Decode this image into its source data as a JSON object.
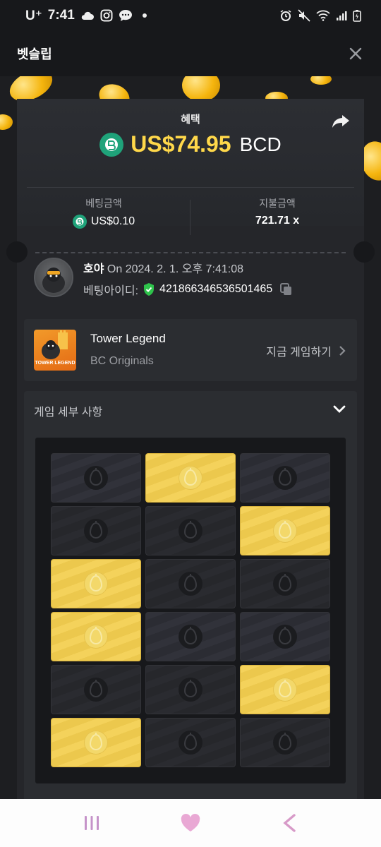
{
  "status_bar": {
    "carrier": "U⁺",
    "time": "7:41"
  },
  "header": {
    "title": "벳슬립"
  },
  "benefit": {
    "label": "혜택",
    "amount": "US$74.95",
    "currency": "BCD"
  },
  "bet_amount": {
    "label": "베팅금액",
    "value": "US$0.10"
  },
  "payout": {
    "label": "지불금액",
    "value": "721.71 x"
  },
  "user": {
    "nickname": "호야",
    "date_prefix": "On",
    "datetime": "2024. 2. 1. 오후 7:41:08",
    "bet_id_label": "베팅아이디:",
    "bet_id": "421866346536501465"
  },
  "game": {
    "name": "Tower Legend",
    "provider": "BC Originals",
    "thumb_label": "TOWER LEGEND",
    "play_label": "지금 게임하기"
  },
  "details": {
    "title": "게임 세부 사항"
  },
  "board": {
    "rows": [
      [
        "dark-hl",
        "gold",
        "dark-hl"
      ],
      [
        "dark",
        "dark",
        "gold"
      ],
      [
        "gold",
        "dark",
        "dark"
      ],
      [
        "gold",
        "dark-hl",
        "dark-hl"
      ],
      [
        "dark",
        "dark",
        "gold"
      ],
      [
        "gold",
        "dark",
        "dark"
      ]
    ]
  },
  "colors": {
    "accent_gold": "#ffd84a",
    "bc_green": "#1fa37a",
    "verified_green": "#2ec34b"
  }
}
